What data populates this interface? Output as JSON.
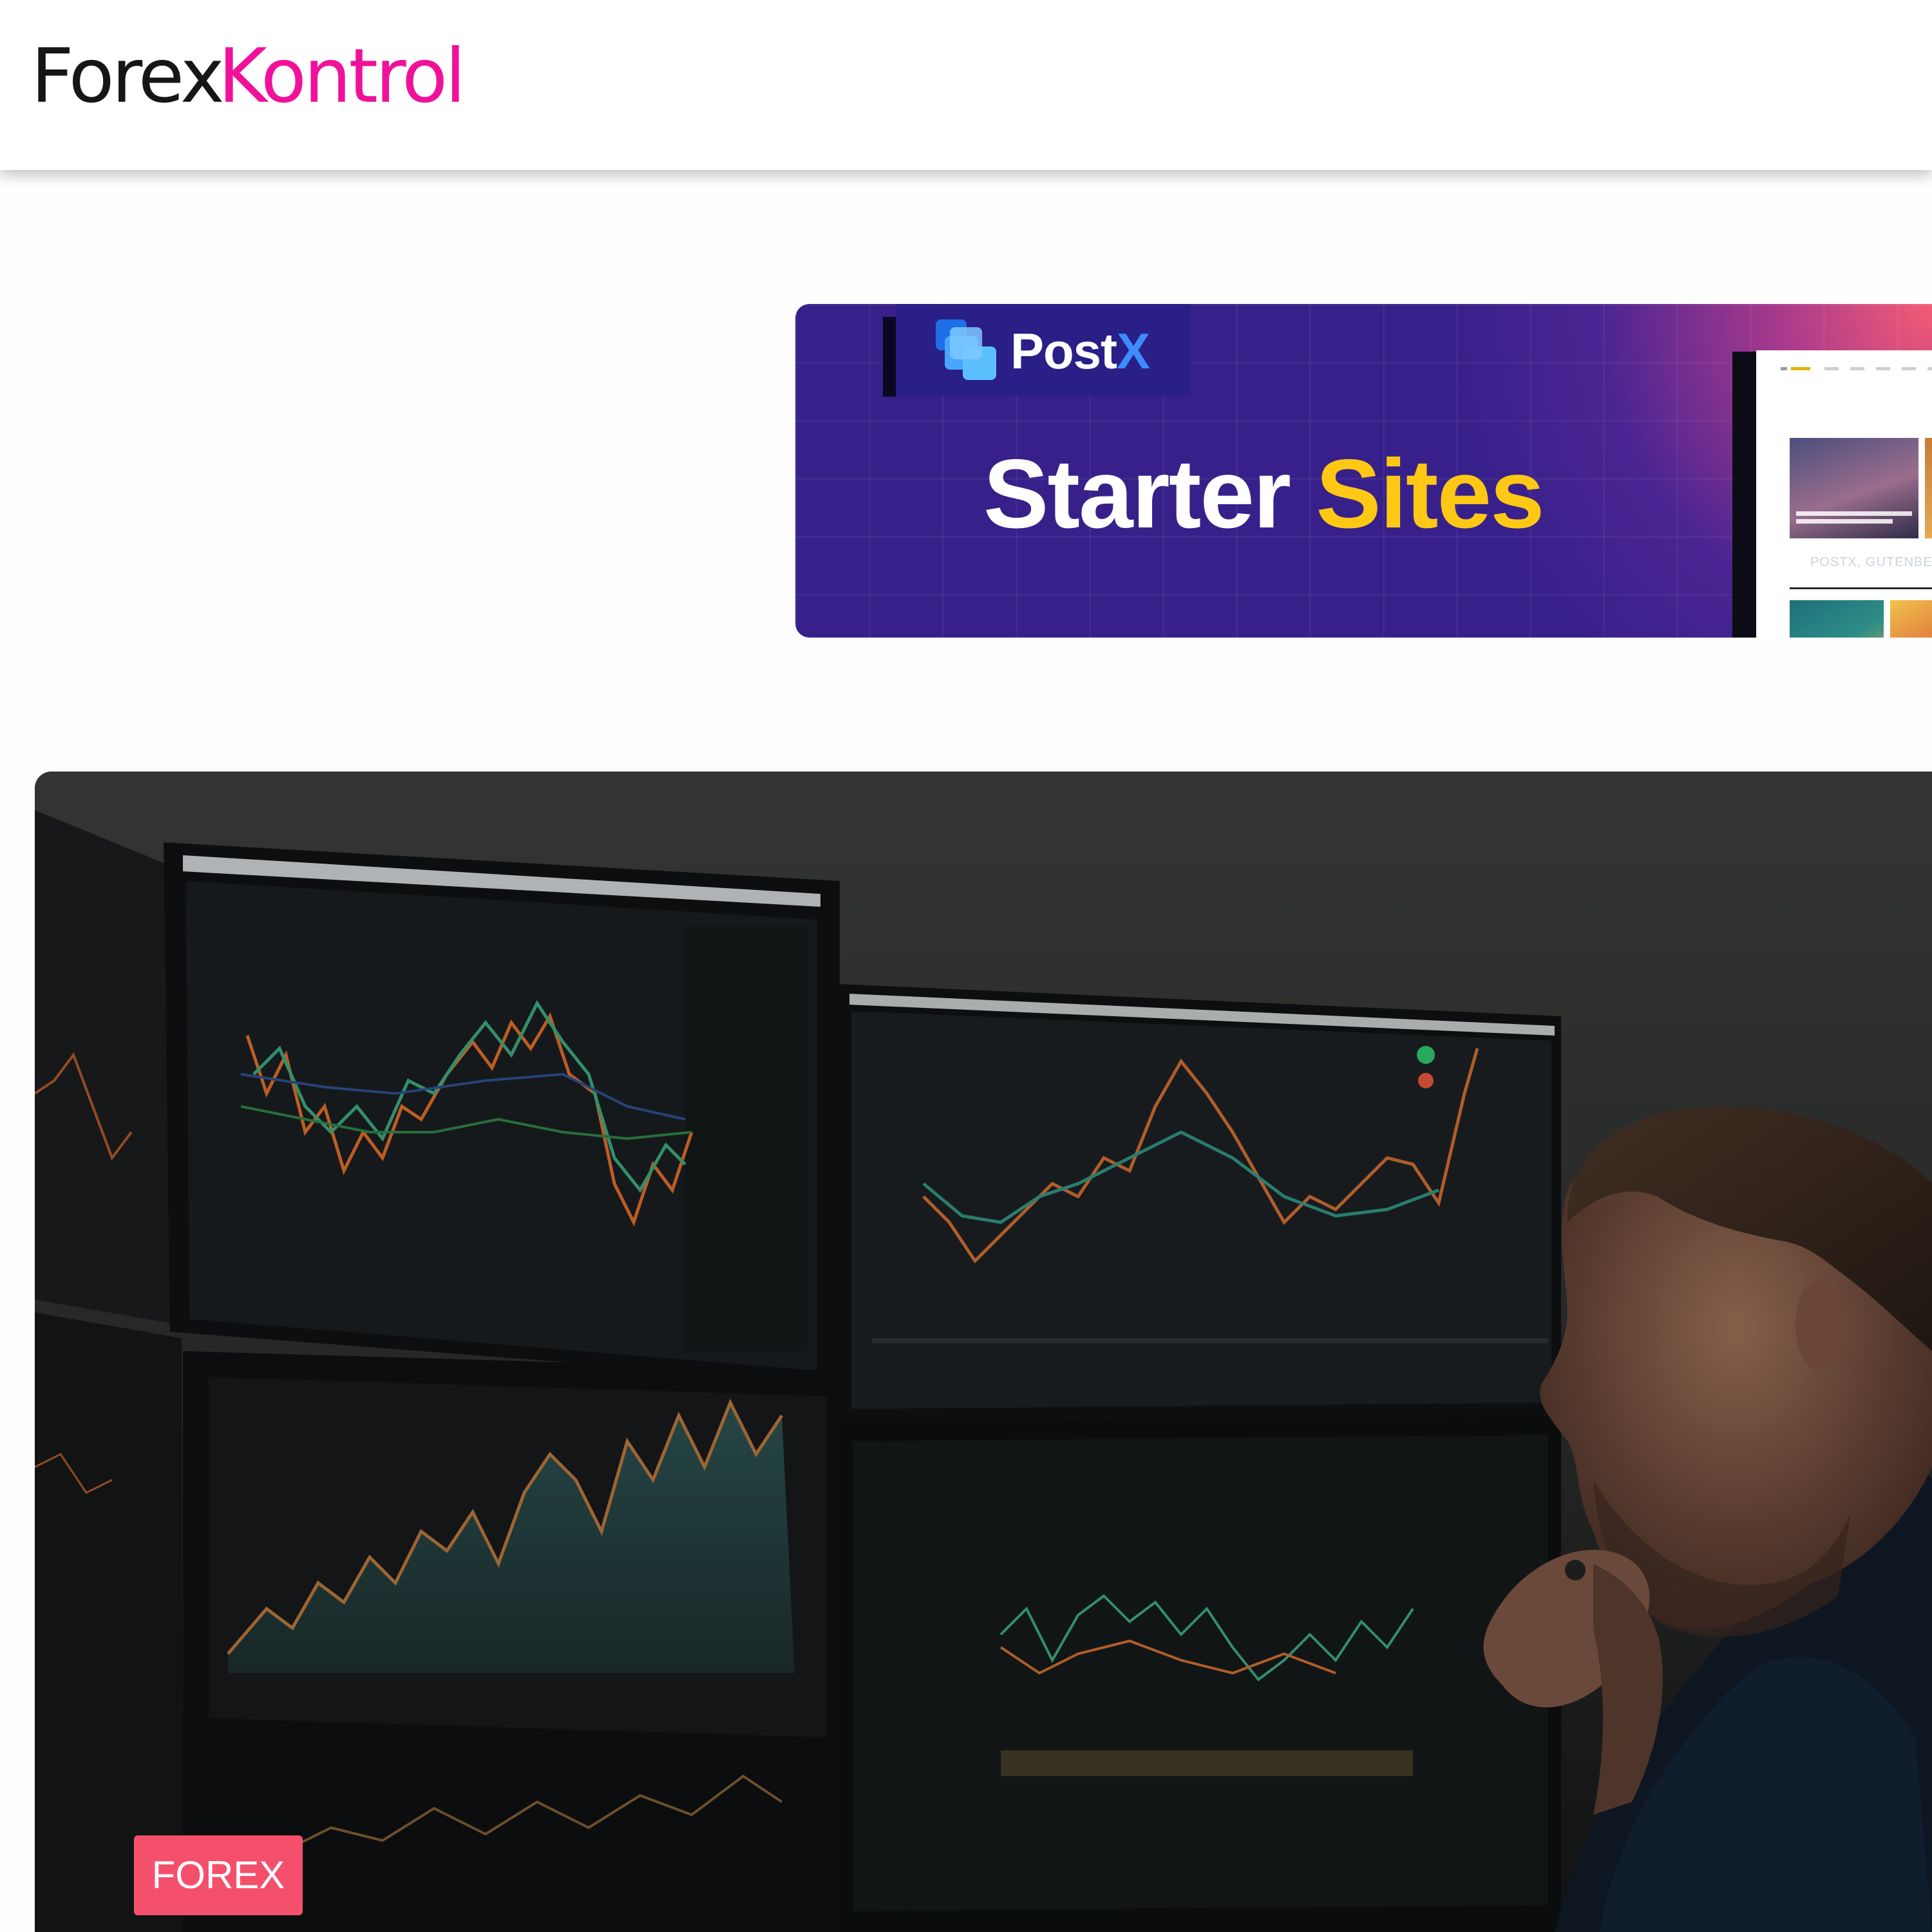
{
  "site": {
    "logo_part1": "Forex",
    "logo_part2": "Kontrol",
    "logo_colors": {
      "dark": "#161616",
      "accent": "#f0119a"
    }
  },
  "ad_banner": {
    "brand": "Post",
    "brand_accent": "X",
    "headline_white": "Starter",
    "headline_yellow": "Sites",
    "mockup_caption": "POSTX, GUTENBERG PO",
    "colors": {
      "background": "#37208a",
      "yellow": "#ffc815",
      "brand_blue": "#3b8dff"
    }
  },
  "featured_post": {
    "category": "FOREX",
    "badge_color": "#f4506c",
    "image": "trader-at-multiple-monitors-photo"
  }
}
